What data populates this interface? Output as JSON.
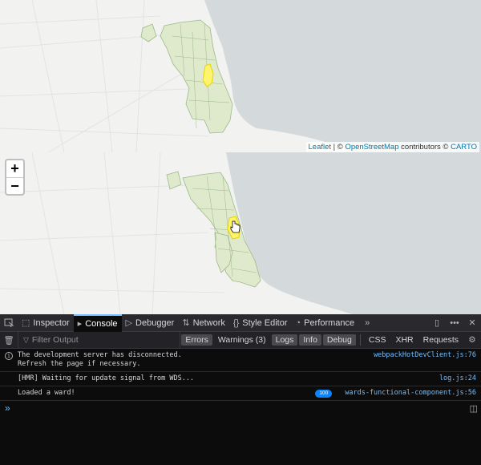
{
  "map": {
    "attribution": {
      "leaflet": "Leaflet",
      "sep": " | © ",
      "osm": "OpenStreetMap",
      "contrib": " contributors © ",
      "carto": "CARTO"
    },
    "zoom_in": "+",
    "zoom_out": "−",
    "colors": {
      "water": "#d4dadc",
      "land": "#f2f2f0",
      "wards": "#dfe9cc",
      "ward_border": "#9cb98a",
      "highlight": "#fff46b"
    }
  },
  "devtools": {
    "tabs": [
      {
        "label": "Inspector",
        "icon": "inspector-icon"
      },
      {
        "label": "Console",
        "icon": "console-icon",
        "active": true
      },
      {
        "label": "Debugger",
        "icon": "debugger-icon"
      },
      {
        "label": "Network",
        "icon": "network-icon"
      },
      {
        "label": "Style Editor",
        "icon": "style-editor-icon"
      },
      {
        "label": "Performance",
        "icon": "performance-icon"
      }
    ],
    "filter": {
      "placeholder": "Filter Output",
      "levels": [
        "Errors",
        "Warnings (3)",
        "Logs",
        "Info",
        "Debug"
      ],
      "types": [
        "CSS",
        "XHR",
        "Requests"
      ]
    },
    "messages": [
      {
        "text": "The development server has disconnected.\nRefresh the page if necessary.",
        "source": "webpackHotDevClient.js:76"
      },
      {
        "text": "[HMR] Waiting for update signal from WDS...",
        "source": "log.js:24"
      },
      {
        "text": "Loaded a ward!",
        "count": "100",
        "source": "wards-functional-component.js:56"
      }
    ],
    "prompt": "»"
  }
}
